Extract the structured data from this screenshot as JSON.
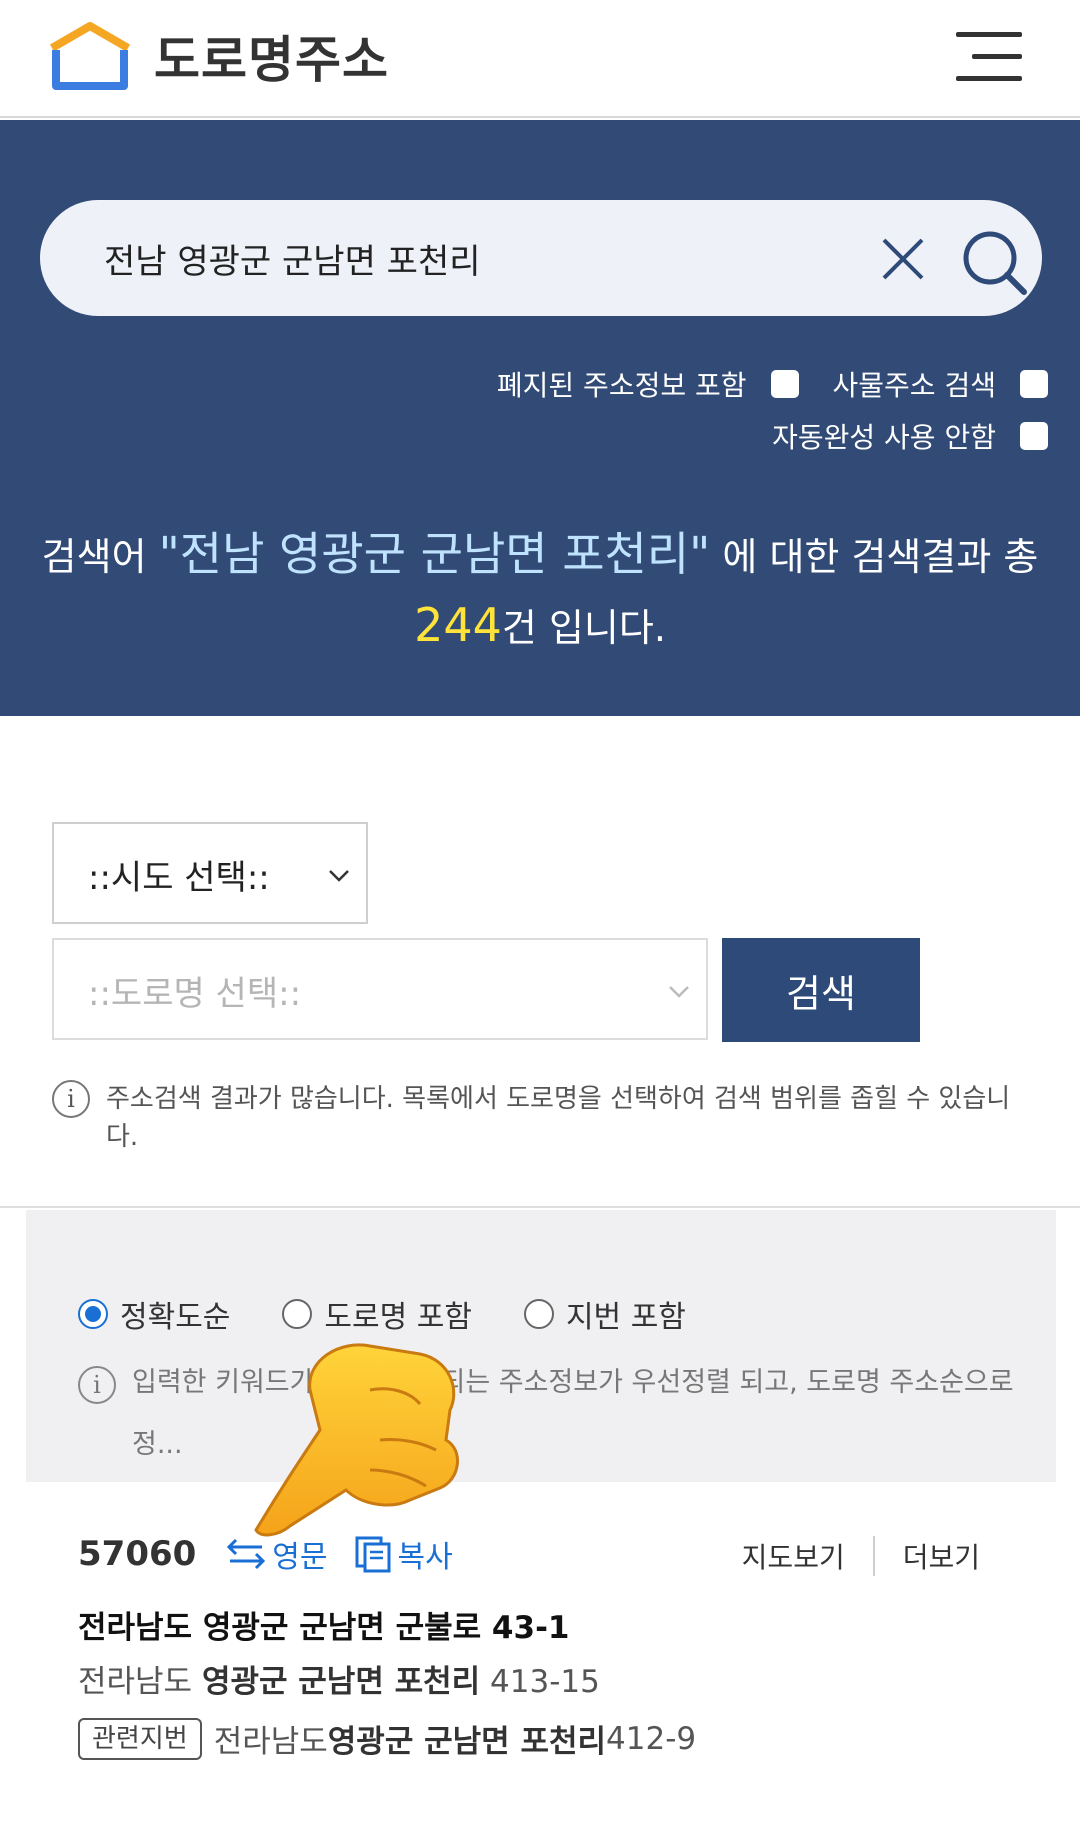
{
  "header": {
    "logo_text": "도로명주소",
    "logo_colors": {
      "orange": "#f5a623",
      "blue": "#3b7de0"
    }
  },
  "search": {
    "query": "전남 영광군 군남면 포천리",
    "clear_icon": "close-icon",
    "search_icon": "search-icon"
  },
  "options": {
    "include_abolished": "폐지된 주소정보 포함",
    "object_address": "사물주소 검색",
    "no_autocomplete": "자동완성 사용 안함"
  },
  "result_summary": {
    "prefix": "검색어 ",
    "keyword": "\"전남 영광군 군남면 포천리\"",
    "middle": " 에 대한 검색결과 총 ",
    "count": "244",
    "suffix": "건 입니다."
  },
  "filter": {
    "sido_label": "::시도 선택::",
    "road_label": "::도로명 선택::",
    "search_button": "검색",
    "note": "주소검색 결과가 많습니다. 목록에서 도로명을 선택하여 검색 범위를 좁힐 수 있습니다."
  },
  "sort": {
    "options": [
      "정확도순",
      "도로명 포함",
      "지번 포함"
    ],
    "selected": "정확도순",
    "note": "입력한 키워드가 ... 에 포함되는 주소정보가 우선정렬 되고, 도로명 주소순으로 정..."
  },
  "result": {
    "zipcode": "57060",
    "english_label": "영문",
    "copy_label": "복사",
    "map_label": "지도보기",
    "more_label": "더보기",
    "road_address": "전라남도 영광군 군남면 군불로 43-1",
    "jibun_prefix": "전라남도 ",
    "jibun_bold": "영광군 군남면 포천리",
    "jibun_suffix": " 413-15",
    "related_tag": "관련지번",
    "related_prefix": "전라남도 ",
    "related_bold": "영광군 군남면 포천리",
    "related_suffix": " 412-9"
  },
  "colors": {
    "banner": "#324b76",
    "button": "#2e4a78",
    "keyword": "#bfe3ff",
    "count": "#ffe33a",
    "link": "#1a6fd4"
  }
}
